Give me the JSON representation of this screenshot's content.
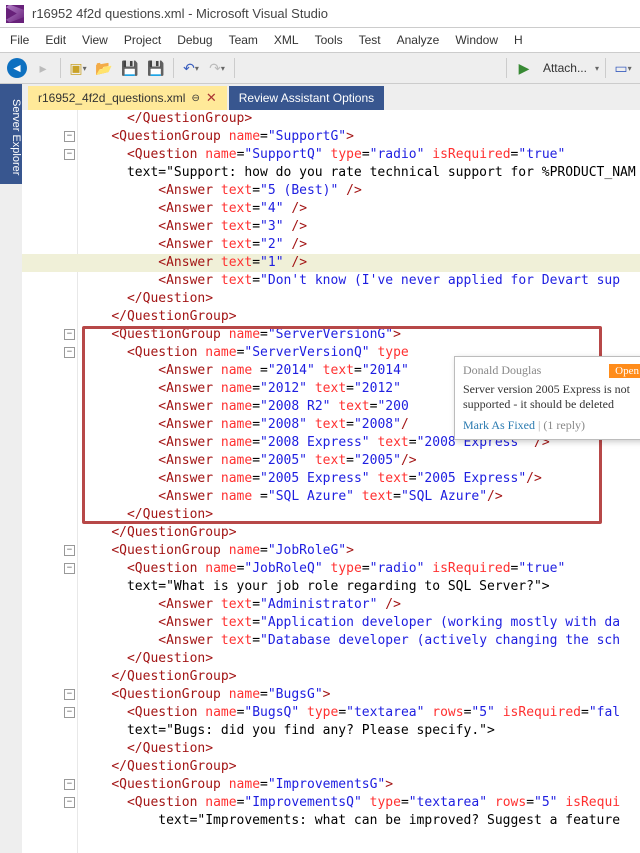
{
  "title": "r16952 4f2d questions.xml - Microsoft Visual Studio",
  "menu": [
    "File",
    "Edit",
    "View",
    "Project",
    "Debug",
    "Team",
    "XML",
    "Tools",
    "Test",
    "Analyze",
    "Window",
    "H"
  ],
  "attach": "Attach...",
  "tabs": {
    "active": "r16952_4f2d_questions.xml",
    "inactive": "Review Assistant Options"
  },
  "sidebar": "Server Explorer",
  "comment": {
    "author": "Donald Douglas",
    "status": "Open",
    "body": "Server version 2005 Express is not supported - it should be deleted",
    "action": "Mark As Fixed",
    "replies": "(1 reply)"
  },
  "code": [
    "      </QuestionGroup>",
    "    <QuestionGroup name=\"SupportG\">",
    "      <Question name=\"SupportQ\" type=\"radio\" isRequired=\"true\"",
    "      text=\"Support: how do you rate technical support for %PRODUCT_NAM",
    "          <Answer text=\"5 (Best)\" />",
    "          <Answer text=\"4\" />",
    "          <Answer text=\"3\" />",
    "          <Answer text=\"2\" />",
    "          <Answer text=\"1\" />",
    "          <Answer text=\"Don't know (I've never applied for Devart sup",
    "      </Question>",
    "    </QuestionGroup>",
    "    <QuestionGroup name=\"ServerVersionG\">",
    "      <Question name=\"ServerVersionQ\" type",
    "          <Answer name =\"2014\" text=\"2014\"",
    "          <Answer name=\"2012\" text=\"2012\"",
    "          <Answer name=\"2008 R2\" text=\"200",
    "          <Answer name=\"2008\" text=\"2008\"/",
    "          <Answer name=\"2008 Express\" text=\"2008 Express\" />",
    "          <Answer name=\"2005\" text=\"2005\"/>",
    "          <Answer name=\"2005 Express\" text=\"2005 Express\"/>",
    "          <Answer name =\"SQL Azure\" text=\"SQL Azure\"/>",
    "      </Question>",
    "    </QuestionGroup>",
    "    <QuestionGroup name=\"JobRoleG\">",
    "      <Question name=\"JobRoleQ\" type=\"radio\" isRequired=\"true\"",
    "      text=\"What is your job role regarding to SQL Server?\">",
    "          <Answer text=\"Administrator\" />",
    "          <Answer text=\"Application developer (working mostly with da",
    "          <Answer text=\"Database developer (actively changing the sch",
    "      </Question>",
    "    </QuestionGroup>",
    "    <QuestionGroup name=\"BugsG\">",
    "      <Question name=\"BugsQ\" type=\"textarea\" rows=\"5\" isRequired=\"fal",
    "      text=\"Bugs: did you find any? Please specify.\">",
    "      </Question>",
    "    </QuestionGroup>",
    "    <QuestionGroup name=\"ImprovementsG\">",
    "      <Question name=\"ImprovementsQ\" type=\"textarea\" rows=\"5\" isRequi",
    "          text=\"Improvements: what can be improved? Suggest a feature"
  ]
}
